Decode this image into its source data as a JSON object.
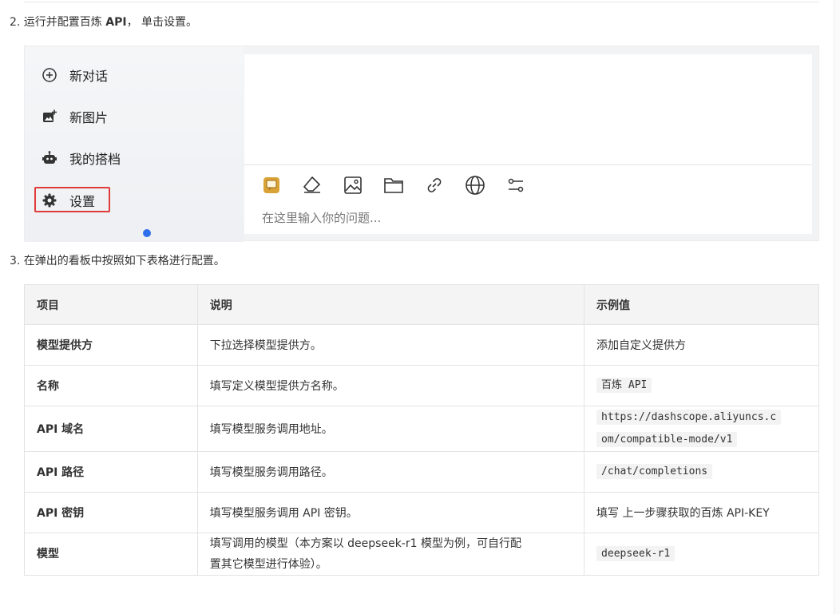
{
  "steps": {
    "step2_prefix": "2. 运行并配置百炼 ",
    "step2_bold": "API",
    "step2_suffix": "， 单击设置。",
    "step3": "3. 在弹出的看板中按照如下表格进行配置。"
  },
  "sidebar": {
    "items": [
      {
        "label": "新对话",
        "icon": "plus-circle-icon"
      },
      {
        "label": "新图片",
        "icon": "image-plus-icon"
      },
      {
        "label": "我的搭档",
        "icon": "robot-icon"
      },
      {
        "label": "设置",
        "icon": "gear-icon"
      }
    ]
  },
  "chat": {
    "placeholder": "在这里输入你的问题...",
    "toolbar_icons": [
      "chat-box-icon",
      "eraser-icon",
      "image-icon",
      "folder-icon",
      "link-icon",
      "globe-icon",
      "sliders-icon"
    ]
  },
  "table": {
    "headers": [
      "项目",
      "说明",
      "示例值"
    ],
    "rows": [
      {
        "name": "模型提供方",
        "desc": "下拉选择模型提供方。",
        "example": "添加自定义提供方",
        "example_code": ""
      },
      {
        "name": "名称",
        "desc": "填写定义模型提供方名称。",
        "example": "",
        "example_code": "百炼 API"
      },
      {
        "name": "API 域名",
        "desc": "填写模型服务调用地址。",
        "example": "",
        "example_code_line1": "https://dashscope.aliyuncs.c",
        "example_code_line2": "om/compatible-mode/v1"
      },
      {
        "name": "API 路径",
        "desc": "填写模型服务调用路径。",
        "example": "",
        "example_code": "/chat/completions"
      },
      {
        "name": "API 密钥",
        "desc": "填写模型服务调用 API 密钥。",
        "example": "填写 上一步骤获取的百炼 API-KEY",
        "example_code": ""
      },
      {
        "name": "模型",
        "desc_line1": "填写调用的模型（本方案以 deepseek-r1 模型为例，可自行配",
        "desc_line2": "置其它模型进行体验）。",
        "example": "",
        "example_code": "deepseek-r1"
      }
    ]
  },
  "colors": {
    "highlight": "#e03b3b",
    "accent_dot": "#2f6fed",
    "chat_icon": "#d9a236"
  }
}
